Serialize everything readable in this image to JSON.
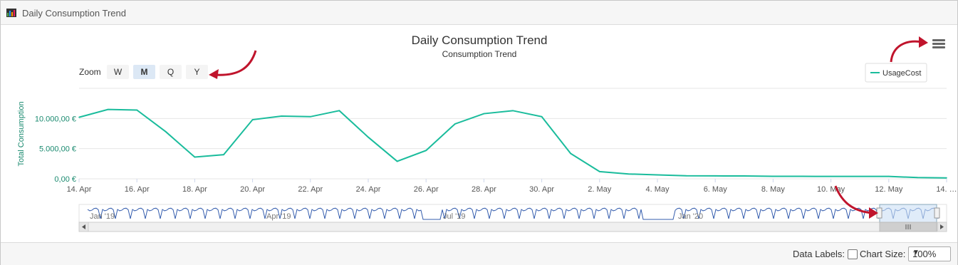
{
  "panel": {
    "title": "Daily Consumption Trend"
  },
  "chart_data": {
    "type": "line",
    "title": "Daily Consumption Trend",
    "subtitle": "Consumption Trend",
    "ylabel": "Total Consumption",
    "ylim": [
      0,
      15000
    ],
    "yticks": [
      "0,00 €",
      "5.000,00 €",
      "10.000,00 €"
    ],
    "ytick_values": [
      0,
      5000,
      10000
    ],
    "x_tick_labels": [
      "14. Apr",
      "16. Apr",
      "18. Apr",
      "20. Apr",
      "22. Apr",
      "24. Apr",
      "26. Apr",
      "28. Apr",
      "30. Apr",
      "2. May",
      "4. May",
      "6. May",
      "8. May",
      "10. May",
      "12. May",
      "14. …"
    ],
    "x_day_start": 0,
    "x_day_end": 30,
    "series": [
      {
        "name": "UsageCost",
        "color": "#1abc9c",
        "x": [
          0,
          1,
          2,
          3,
          4,
          5,
          6,
          7,
          8,
          9,
          10,
          11,
          12,
          13,
          14,
          15,
          16,
          17,
          18,
          19,
          20,
          21,
          22,
          23,
          24,
          25,
          26,
          27,
          28,
          29,
          30
        ],
        "values": [
          10200,
          11500,
          11400,
          7800,
          3600,
          4000,
          9800,
          10400,
          10300,
          11300,
          6900,
          2900,
          4700,
          9100,
          10800,
          11300,
          10300,
          4200,
          1200,
          800,
          650,
          500,
          480,
          470,
          420,
          410,
          400,
          400,
          400,
          200,
          150
        ]
      }
    ],
    "legend": "top-right",
    "grid": true,
    "navigator_labels": [
      "Jan '19",
      "Apr '19",
      "Jul '19",
      "Jan '20"
    ]
  },
  "zoom": {
    "label": "Zoom",
    "buttons": [
      "W",
      "M",
      "Q",
      "Y"
    ],
    "selected": "M"
  },
  "menu_icon": "hamburger-menu-icon",
  "footer": {
    "data_labels": "Data Labels:",
    "chart_size": "Chart Size:",
    "chart_size_value": "100%"
  }
}
